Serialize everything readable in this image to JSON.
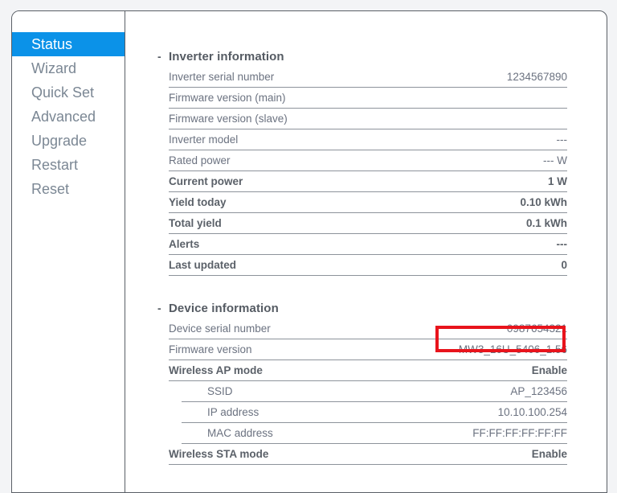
{
  "sidebar": {
    "items": [
      {
        "label": "Status",
        "active": true
      },
      {
        "label": "Wizard",
        "active": false
      },
      {
        "label": "Quick Set",
        "active": false
      },
      {
        "label": "Advanced",
        "active": false
      },
      {
        "label": "Upgrade",
        "active": false
      },
      {
        "label": "Restart",
        "active": false
      },
      {
        "label": "Reset",
        "active": false
      }
    ]
  },
  "colors": {
    "accent": "#0b92e8",
    "highlight": "#e8141c",
    "text": "#6b7280",
    "heading": "#555b63",
    "border": "#8d939b",
    "page_background": "#f3f4f6"
  },
  "sections": [
    {
      "marker": "-",
      "title": "Inverter information",
      "rows": [
        {
          "label": "Inverter serial number",
          "value": "1234567890",
          "bold": false,
          "indent": false
        },
        {
          "label": "Firmware version (main)",
          "value": "",
          "bold": false,
          "indent": false
        },
        {
          "label": "Firmware version (slave)",
          "value": "",
          "bold": false,
          "indent": false
        },
        {
          "label": "Inverter model",
          "value": "---",
          "bold": false,
          "indent": false
        },
        {
          "label": "Rated power",
          "value": "--- W",
          "bold": false,
          "indent": false
        },
        {
          "label": "Current power",
          "value": "1 W",
          "bold": true,
          "indent": false
        },
        {
          "label": "Yield today",
          "value": "0.10 kWh",
          "bold": true,
          "indent": false
        },
        {
          "label": "Total yield",
          "value": "0.1 kWh",
          "bold": true,
          "indent": false
        },
        {
          "label": "Alerts",
          "value": "---",
          "bold": true,
          "indent": false
        },
        {
          "label": "Last updated",
          "value": "0",
          "bold": true,
          "indent": false
        }
      ]
    },
    {
      "marker": "-",
      "title": "Device information",
      "rows": [
        {
          "label": "Device serial number",
          "value": "0987654321",
          "bold": false,
          "indent": false
        },
        {
          "label": "Firmware version",
          "value": "MW3_16U_5406_1.56",
          "bold": false,
          "indent": false
        },
        {
          "label": "Wireless AP mode",
          "value": "Enable",
          "bold": true,
          "indent": false
        },
        {
          "label": "SSID",
          "value": "AP_123456",
          "bold": false,
          "indent": true
        },
        {
          "label": "IP address",
          "value": "10.10.100.254",
          "bold": false,
          "indent": true
        },
        {
          "label": "MAC address",
          "value": "FF:FF:FF:FF:FF:FF",
          "bold": false,
          "indent": true
        },
        {
          "label": "Wireless STA mode",
          "value": "Enable",
          "bold": true,
          "indent": false
        }
      ]
    }
  ],
  "annotation": {
    "target_label": "Firmware version",
    "target_value": "MW3_16U_5406_1.56"
  }
}
